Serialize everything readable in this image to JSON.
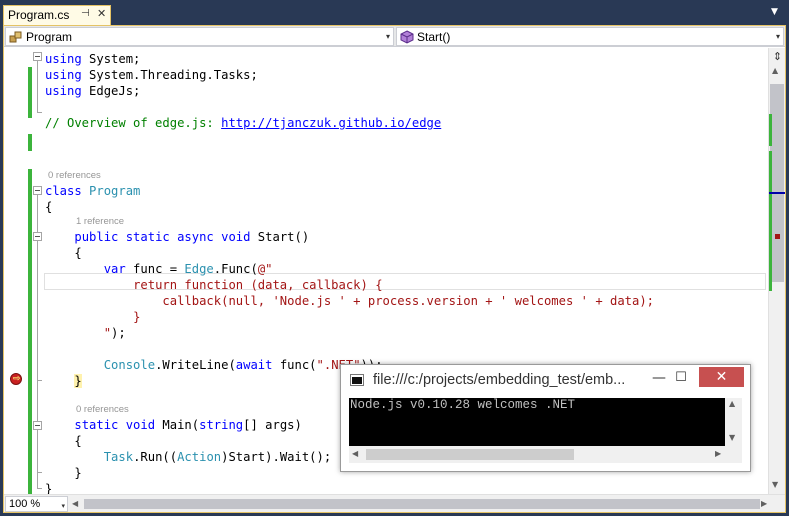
{
  "tab": {
    "title": "Program.cs",
    "pin_glyph": "⊣",
    "close_glyph": "✕",
    "dropdown_glyph": "▼"
  },
  "navbar": {
    "class_combo": "Program",
    "member_combo": "Start()",
    "arrow": "▾"
  },
  "code": {
    "lines": {
      "l1": {
        "kw": "using",
        "rest": " System;"
      },
      "l2": {
        "kw": "using",
        "rest": " System.Threading.Tasks;"
      },
      "l3": {
        "kw": "using",
        "rest": " EdgeJs;"
      },
      "l4": {
        "comment": "// Overview of edge.js: ",
        "link": "http://tjanczuk.github.io/edge"
      },
      "l5": {
        "lens": "0 references"
      },
      "l6": {
        "kw": "class",
        "type": "Program"
      },
      "l7": {
        "text": "{"
      },
      "l8": {
        "lens": "1 reference"
      },
      "l9": {
        "kw": "public static async void",
        "rest": " Start()"
      },
      "l10": {
        "text": "{"
      },
      "l11": {
        "kw": "var",
        "mid": " func = ",
        "type": "Edge",
        "rest": ".Func(",
        "str": "@\""
      },
      "l12": {
        "str": "return function (data, callback) {"
      },
      "l13": {
        "str": "callback(null, 'Node.js ' + process.version + ' welcomes ' + data);"
      },
      "l14": {
        "str": "}"
      },
      "l15": {
        "str": "\"",
        "rest": ");"
      },
      "l16": {
        "type": "Console",
        "mid": ".WriteLine(",
        "kw": "await",
        "rest": " func(",
        "str": "\".NET\"",
        "end": "));"
      },
      "l17": {
        "text": "}"
      },
      "l18": {
        "lens": "0 references"
      },
      "l19": {
        "kw": "static void",
        "rest": " Main(",
        "kw2": "string",
        "end": "[] args)"
      },
      "l20": {
        "text": "{"
      },
      "l21": {
        "type": "Task",
        "mid": ".Run((",
        "type2": "Action",
        "rest": ")Start).Wait();"
      },
      "l22": {
        "text": "}"
      },
      "l23": {
        "text": "}"
      }
    }
  },
  "zoom": {
    "value": "100 %",
    "arrow": "▾"
  },
  "scroll": {
    "up": "▲",
    "down": "▼",
    "left": "◀",
    "right": "▶",
    "split": "⇕"
  },
  "console": {
    "title": "file:///c:/projects/embedding_test/emb...",
    "output": "Node.js v0.10.28 welcomes .NET",
    "min": "—",
    "max": "☐",
    "close": "✕",
    "up": "▲",
    "down": "▼",
    "left": "◀",
    "right": "▶"
  },
  "breakpoint": {
    "arrow": "⇨"
  },
  "colors": {
    "keyword": "#0000ff",
    "type": "#2b91af",
    "string": "#a31515",
    "comment": "#008000",
    "change_bar": "#3cb43c",
    "frame": "#293955",
    "tab_accent": "#e5c365",
    "close_button": "#c75050"
  }
}
